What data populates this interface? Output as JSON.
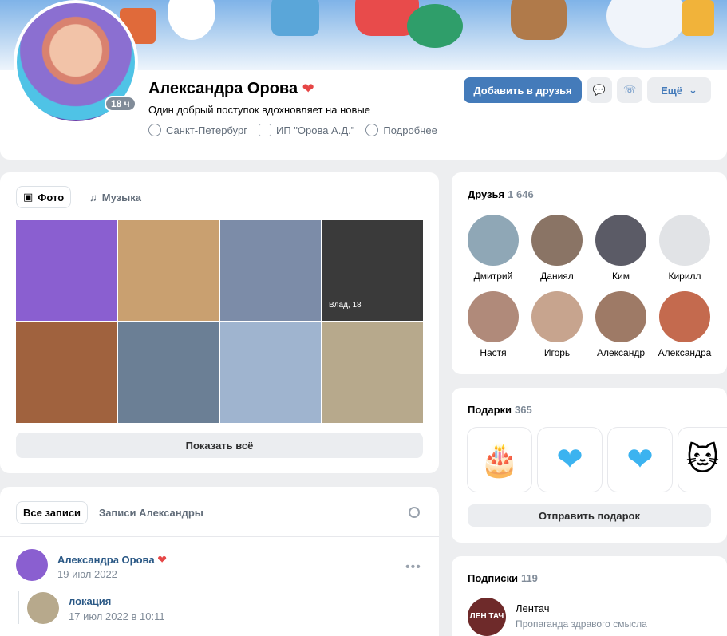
{
  "profile": {
    "name": "Александра Орова",
    "status": "Один добрый поступок вдохновляет на новые",
    "age_badge": "18 ч",
    "city": "Санкт-Петербург",
    "work": "ИП \"Орова А.Д.\"",
    "more_info": "Подробнее",
    "add_friend": "Добавить в друзья",
    "more_button": "Ещё"
  },
  "photos": {
    "tab_photo": "Фото",
    "tab_music": "Музыка",
    "show_all": "Показать всё",
    "photo_caption": "Влад, 18",
    "photo_colors": [
      "#8a5fd0",
      "#c9a070",
      "#7c8ca8",
      "#3a3a3a",
      "#a0623e",
      "#6b7f95",
      "#9fb4cf",
      "#b7a98c"
    ]
  },
  "posts": {
    "tab_all": "Все записи",
    "tab_own": "Записи Александры",
    "author": "Александра Орова",
    "date": "19 июл 2022",
    "repost_author": "локация",
    "repost_date": "17 июл 2022 в 10:11"
  },
  "friends": {
    "title": "Друзья",
    "count": "1 646",
    "items": [
      {
        "name": "Дмитрий",
        "color": "#8fa7b6"
      },
      {
        "name": "Даниял",
        "color": "#8a7465"
      },
      {
        "name": "Ким",
        "color": "#5b5b66"
      },
      {
        "name": "Кирилл",
        "color": "#e1e3e6"
      },
      {
        "name": "Настя",
        "color": "#b08a7a"
      },
      {
        "name": "Игорь",
        "color": "#c7a48e"
      },
      {
        "name": "Александр",
        "color": "#9e7a66"
      },
      {
        "name": "Александра",
        "color": "#c46a4e"
      }
    ]
  },
  "gifts": {
    "title": "Подарки",
    "count": "365",
    "send": "Отправить подарок",
    "items": [
      "cake-gift-icon",
      "blue-heart-gift-icon",
      "blue-heart-gift-icon",
      "cat-gift-icon"
    ]
  },
  "subs": {
    "title": "Подписки",
    "count": "119",
    "name": "Лентач",
    "desc": "Пропаганда здравого смысла",
    "logo_text": "ЛЕН ТАЧ"
  }
}
